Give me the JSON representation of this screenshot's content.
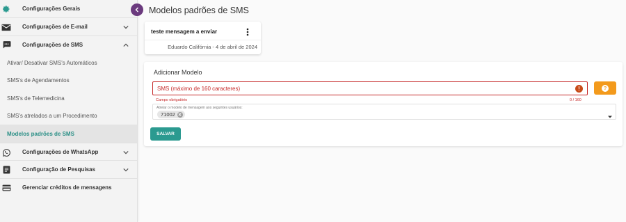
{
  "sidebar": {
    "items": [
      {
        "label": "Configurações Gerais",
        "icon": "gear-icon"
      },
      {
        "label": "Configurações de E-mail",
        "icon": "envelope-icon"
      },
      {
        "label": "Configurações de SMS",
        "icon": "sms-icon"
      },
      {
        "label": "Configurações de WhatsApp",
        "icon": "whatsapp-icon"
      },
      {
        "label": "Configuração de Pesquisas",
        "icon": "survey-icon"
      },
      {
        "label": "Gerenciar créditos de mensagens",
        "icon": "credit-card-icon"
      }
    ],
    "sms_subitems": [
      "Ativar/ Desativar SMS's Automáticos",
      "SMS's de Agendamentos",
      "SMS's de Telemedicina",
      "SMS's atrelados a um Procedimento",
      "Modelos padrões de SMS"
    ],
    "active_subitem": "Modelos padrões de SMS"
  },
  "header": {
    "title": "Modelos padrões de SMS"
  },
  "template_card": {
    "title": "teste mensagem a enviar",
    "meta": "Eduardo Califórnia - 4 de abril de 2024"
  },
  "form": {
    "title": "Adicionar Modelo",
    "sms_placeholder": "SMS (máximo de 160 caracteres)",
    "error_text": "Campo obrigatório",
    "counter": "0 / 160",
    "users_label": "Atrelar o modelo de mensagem aos seguintes usuários:",
    "selected_users": [
      "71002"
    ],
    "save_label": "SALVAR"
  },
  "colors": {
    "accent": "#2b9a90",
    "error": "#c62828",
    "help_button": "#f39a1c",
    "collapse_button": "#6b3a7e"
  }
}
